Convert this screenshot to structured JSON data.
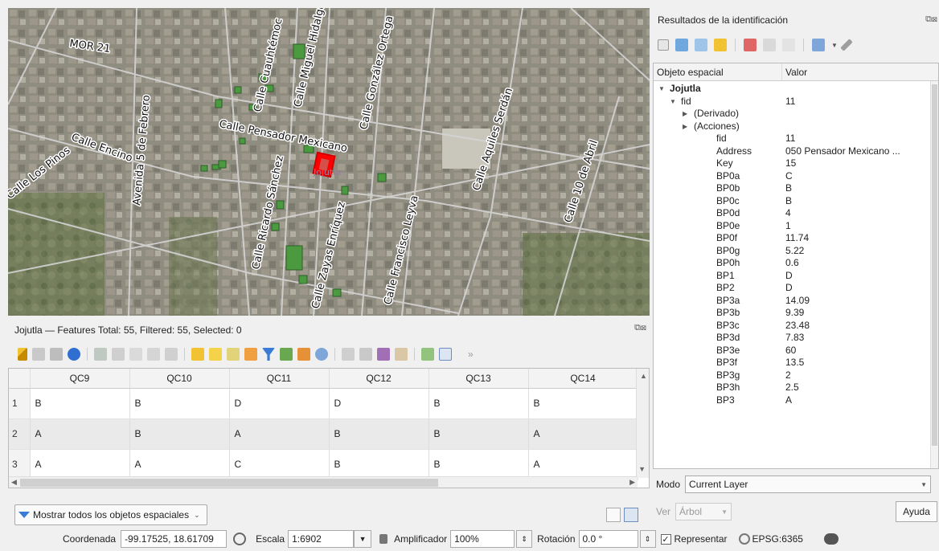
{
  "map": {
    "streets": [
      "MOR 21",
      "Calle Cuauhtémoc",
      "Calle Miguel Hidalgo",
      "Calle González Ortega",
      "Calle Pensador Mexicano",
      "Calle Aquiles Serdán",
      "Calle Encino",
      "Avenida 5 de Febrero",
      "Calle Los Pinos",
      "Calle Ricardo Sánchez",
      "Calle Zayas Enríquez",
      "Calle Francisco Leyva",
      "Calle 10 de Abril"
    ],
    "place": "Jojutla"
  },
  "attribute_table": {
    "title": "Jojutla — Features Total: 55, Filtered: 55, Selected: 0",
    "panel_controls": "⧉⊠",
    "columns": [
      "QC9",
      "QC10",
      "QC11",
      "QC12",
      "QC13",
      "QC14"
    ],
    "rows": [
      {
        "n": "1",
        "cells": [
          "B",
          "B",
          "D",
          "D",
          "B",
          "B"
        ]
      },
      {
        "n": "2",
        "cells": [
          "A",
          "B",
          "A",
          "B",
          "B",
          "A"
        ]
      },
      {
        "n": "3",
        "cells": [
          "A",
          "A",
          "C",
          "B",
          "B",
          "A"
        ]
      }
    ],
    "filter_button": "Mostrar todos los objetos espaciales",
    "more": "»"
  },
  "identify": {
    "title": "Resultados de la identificación",
    "panel_controls": "⧉⊠",
    "col_feature": "Objeto espacial",
    "col_value": "Valor",
    "layer": "Jojutla",
    "fid_key": "fid",
    "fid_value": "11",
    "derived": "(Derivado)",
    "actions": "(Acciones)",
    "attributes": [
      {
        "k": "fid",
        "v": "11"
      },
      {
        "k": "Address",
        "v": "050 Pensador Mexicano ..."
      },
      {
        "k": "Key",
        "v": "15"
      },
      {
        "k": "BP0a",
        "v": "C"
      },
      {
        "k": "BP0b",
        "v": "B"
      },
      {
        "k": "BP0c",
        "v": "B"
      },
      {
        "k": "BP0d",
        "v": "4"
      },
      {
        "k": "BP0e",
        "v": "1"
      },
      {
        "k": "BP0f",
        "v": "11.74"
      },
      {
        "k": "BP0g",
        "v": "5.22"
      },
      {
        "k": "BP0h",
        "v": "0.6"
      },
      {
        "k": "BP1",
        "v": "D"
      },
      {
        "k": "BP2",
        "v": "D"
      },
      {
        "k": "BP3a",
        "v": "14.09"
      },
      {
        "k": "BP3b",
        "v": "9.39"
      },
      {
        "k": "BP3c",
        "v": "23.48"
      },
      {
        "k": "BP3d",
        "v": "7.83"
      },
      {
        "k": "BP3e",
        "v": "60"
      },
      {
        "k": "BP3f",
        "v": "13.5"
      },
      {
        "k": "BP3g",
        "v": "2"
      },
      {
        "k": "BP3h",
        "v": "2.5"
      },
      {
        "k": "BP3",
        "v": "A"
      }
    ],
    "modo_label": "Modo",
    "modo_value": "Current Layer",
    "ver_label": "Ver",
    "ver_value": "Árbol",
    "help_button": "Ayuda"
  },
  "status_bar": {
    "coord_label": "Coordenada",
    "coord_value": "-99.17525, 18.61709",
    "scale_label": "Escala",
    "scale_value": "1:6902",
    "magnifier_label": "Amplificador",
    "magnifier_value": "100%",
    "rotation_label": "Rotación",
    "rotation_value": "0.0 °",
    "render_label": "Representar",
    "crs": "EPSG:6365"
  },
  "colors": {
    "accent": "#3a7bd5",
    "selected_feature": "#ff0000",
    "building_fill": "#4c9a40",
    "road": "#cfcfcf"
  }
}
